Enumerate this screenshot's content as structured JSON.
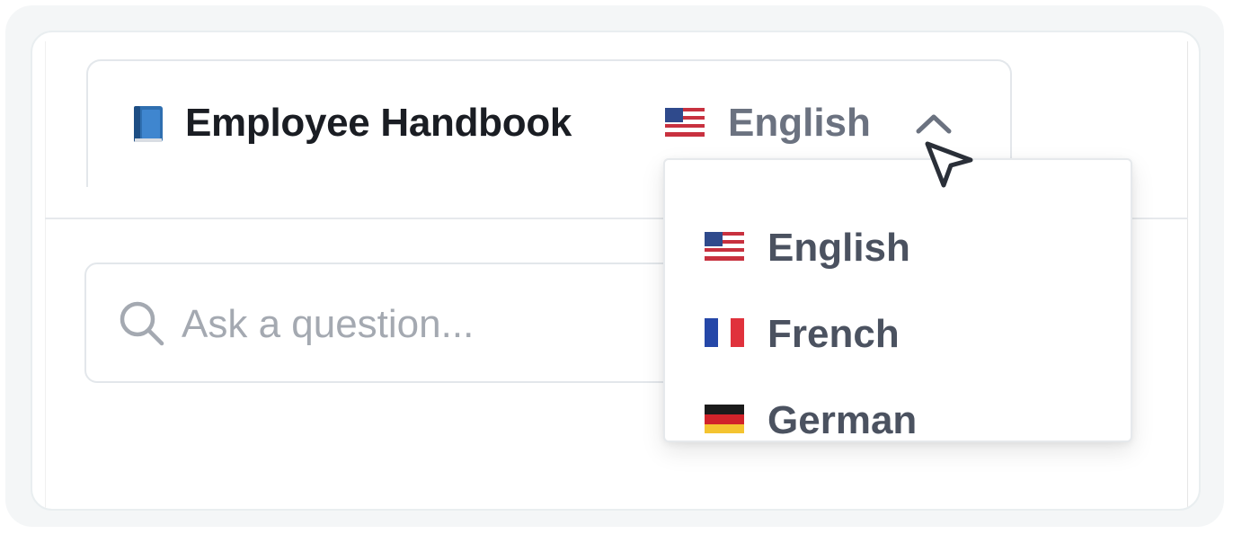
{
  "header": {
    "icon": "blue-book-icon",
    "title": "Employee Handbook",
    "language_selector": {
      "flag_icon": "us-flag-icon",
      "selected": "English",
      "chevron_icon": "chevron-up-icon"
    }
  },
  "search": {
    "icon": "search-icon",
    "placeholder": "Ask a question..."
  },
  "language_dropdown": {
    "options": [
      {
        "flag_icon": "us-flag-icon",
        "label": "English"
      },
      {
        "flag_icon": "france-flag-icon",
        "label": "French"
      },
      {
        "flag_icon": "germany-flag-icon",
        "label": "German"
      }
    ]
  },
  "colors": {
    "title": "#1a1d23",
    "muted_text": "#6b7280",
    "option_text": "#4b5260",
    "placeholder": "#a4a9b1",
    "book_blue": "#2f6fb0"
  }
}
